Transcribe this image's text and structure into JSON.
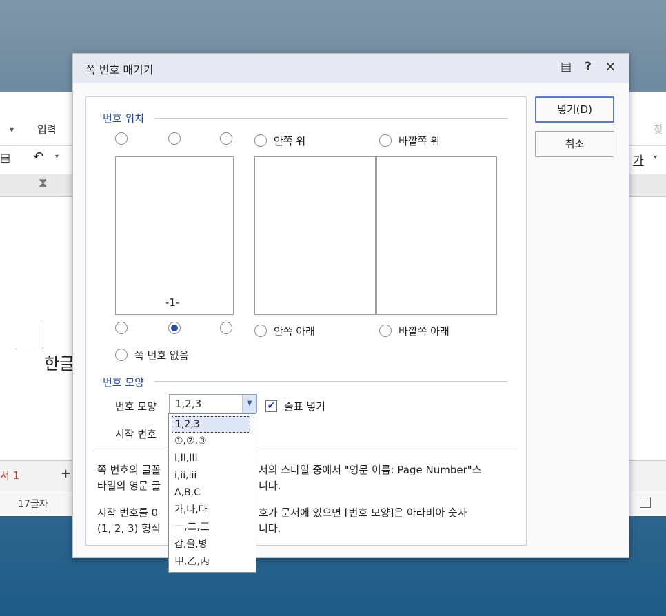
{
  "app": {
    "menu_input": "입력",
    "menu_find": "찾",
    "font_style_label": "가",
    "doc_text": "한글",
    "tab_name": "서 1",
    "tab_add": "+",
    "status_chars": "17글자"
  },
  "dialog": {
    "title": "쪽 번호 매기기",
    "help_icon": "?",
    "close_icon": "×",
    "section_position": "번호 위치",
    "inner_top": "안쪽 위",
    "outer_top": "바깥쪽 위",
    "inner_bottom": "안쪽 아래",
    "outer_bottom": "바깥쪽 아래",
    "no_number": "쪽 번호 없음",
    "preview_number": "-1-",
    "section_shape": "번호 모양",
    "shape_label": "번호 모양",
    "shape_value": "1,2,3",
    "start_label": "시작 번호",
    "dash_label": "줄표 넣기",
    "insert_button": "넣기(D)",
    "cancel_button": "취소",
    "note1_line1a": "쪽 번호의 글꼴",
    "note1_line1b": "서의 스타일 중에서 \"영문 이름: Page Number\"스",
    "note1_line2a": "타일의 영문 글",
    "note1_line2b": "니다.",
    "note2_line1a": "시작 번호를 0",
    "note2_line1b": "호가 문서에 있으면 [번호 모양]은 아라비아 숫자",
    "note2_line2a": "(1, 2, 3) 형식",
    "note2_line2b": "니다."
  },
  "dropdown_options": [
    "1,2,3",
    "①,②,③",
    "I,II,III",
    "i,ii,iii",
    "A,B,C",
    "가,나,다",
    "一,二,三",
    "갑,을,병",
    "甲,乙,丙"
  ],
  "colors": {
    "accent": "#2b4aa0",
    "section_text": "#2a4b8c",
    "titlebar": "#e6e9f2"
  }
}
